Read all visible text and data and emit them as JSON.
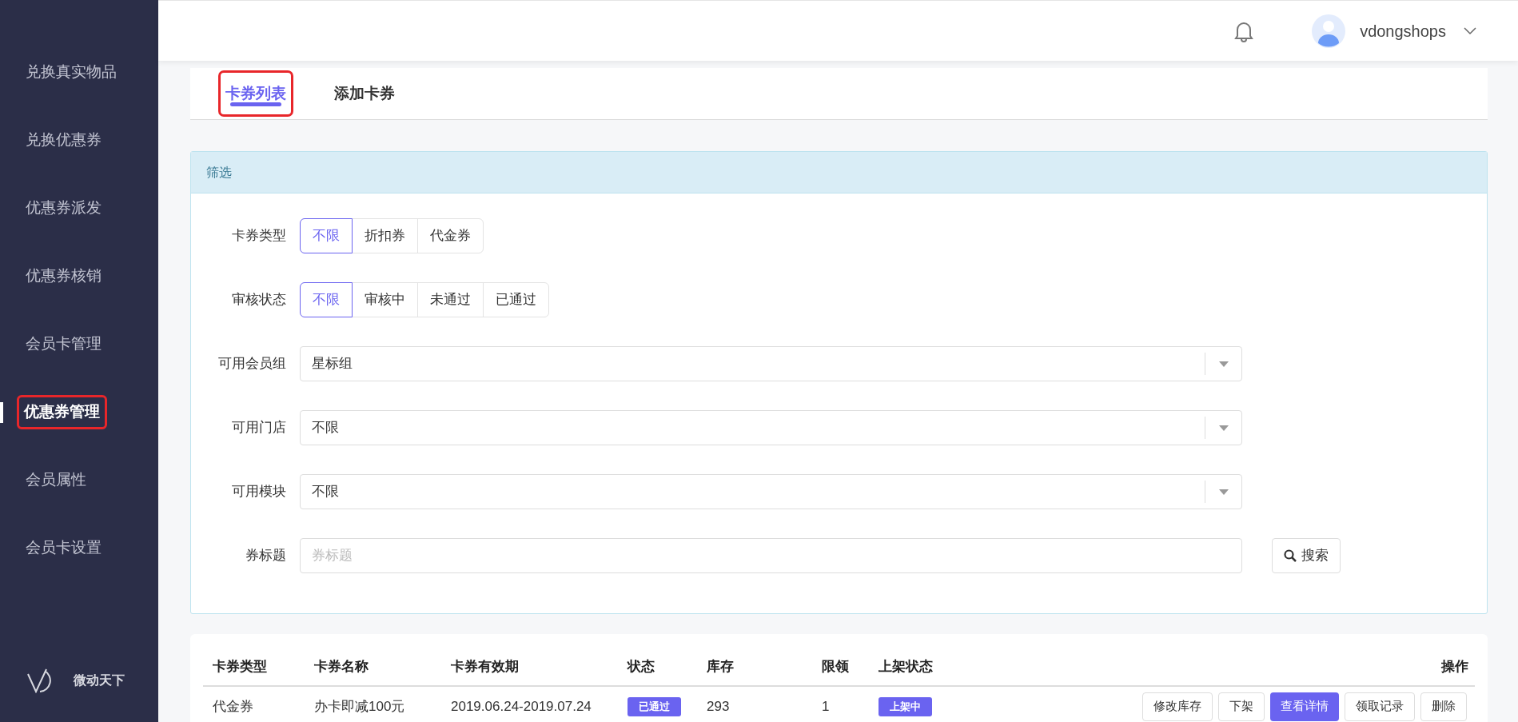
{
  "sidebar": {
    "items": [
      {
        "label": "兑换真实物品",
        "selected": false,
        "highlighted": false
      },
      {
        "label": "兑换优惠券",
        "selected": false,
        "highlighted": false
      },
      {
        "label": "优惠券派发",
        "selected": false,
        "highlighted": false
      },
      {
        "label": "优惠券核销",
        "selected": false,
        "highlighted": false
      },
      {
        "label": "会员卡管理",
        "selected": false,
        "highlighted": false
      },
      {
        "label": "优惠券管理",
        "selected": true,
        "highlighted": true
      },
      {
        "label": "会员属性",
        "selected": false,
        "highlighted": false
      },
      {
        "label": "会员卡设置",
        "selected": false,
        "highlighted": false
      }
    ],
    "logo_text": "微动天下"
  },
  "header": {
    "username": "vdongshops"
  },
  "tabs": [
    {
      "label": "卡券列表",
      "selected": true,
      "highlighted": true
    },
    {
      "label": "添加卡券",
      "selected": false,
      "highlighted": false
    }
  ],
  "filter": {
    "title": "筛选",
    "fields": [
      {
        "kind": "segmented",
        "label": "卡券类型",
        "options": [
          {
            "label": "不限",
            "selected": true
          },
          {
            "label": "折扣券",
            "selected": false
          },
          {
            "label": "代金券",
            "selected": false
          }
        ]
      },
      {
        "kind": "segmented",
        "label": "审核状态",
        "options": [
          {
            "label": "不限",
            "selected": true
          },
          {
            "label": "审核中",
            "selected": false
          },
          {
            "label": "未通过",
            "selected": false
          },
          {
            "label": "已通过",
            "selected": false
          }
        ]
      },
      {
        "kind": "select",
        "label": "可用会员组",
        "value": "星标组"
      },
      {
        "kind": "select",
        "label": "可用门店",
        "value": "不限"
      },
      {
        "kind": "select",
        "label": "可用模块",
        "value": "不限"
      },
      {
        "kind": "text",
        "label": "券标题",
        "placeholder": "券标题",
        "search_button": "搜索"
      }
    ]
  },
  "table": {
    "columns": [
      "卡券类型",
      "卡券名称",
      "卡券有效期",
      "状态",
      "库存",
      "限领",
      "上架状态",
      "操作"
    ],
    "rows": [
      {
        "cells": [
          {
            "kind": "text",
            "text": "代金券"
          },
          {
            "kind": "text",
            "text": "办卡即减100元"
          },
          {
            "kind": "text",
            "text": "2019.06.24-2019.07.24"
          },
          {
            "kind": "badge",
            "text": "已通过"
          },
          {
            "kind": "text",
            "text": "293"
          },
          {
            "kind": "text",
            "text": "1"
          },
          {
            "kind": "badge",
            "text": "上架中"
          }
        ],
        "actions": [
          {
            "label": "修改库存",
            "primary": false
          },
          {
            "label": "下架",
            "primary": false
          },
          {
            "label": "查看详情",
            "primary": true
          },
          {
            "label": "领取记录",
            "primary": false
          },
          {
            "label": "删除",
            "primary": false
          }
        ]
      }
    ]
  }
}
